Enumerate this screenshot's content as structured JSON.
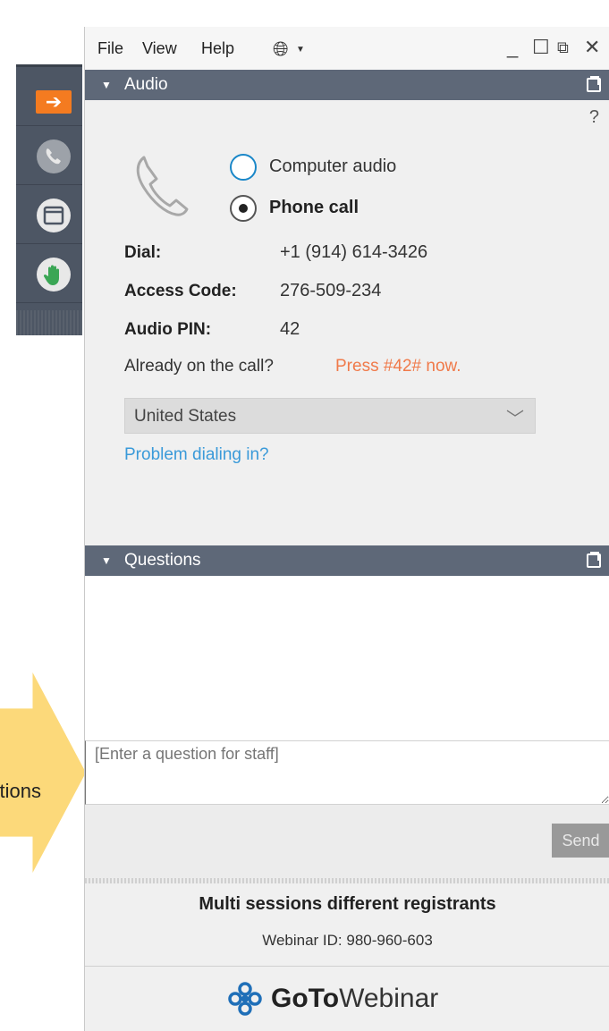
{
  "callout": {
    "text": "Questions"
  },
  "menu": {
    "file": "File",
    "view": "View",
    "help": "Help"
  },
  "audio": {
    "title": "Audio",
    "help": "?",
    "options": [
      {
        "label": "Computer audio",
        "selected": false
      },
      {
        "label": "Phone call",
        "selected": true
      }
    ],
    "dial_label": "Dial:",
    "dial_value": "+1 (914) 614-3426",
    "access_label": "Access Code:",
    "access_value": "276-509-234",
    "pin_label": "Audio PIN:",
    "pin_value": "42",
    "already_text": "Already on the call?",
    "press_text": "Press #42# now.",
    "country": "United States",
    "problem_link": "Problem dialing in?"
  },
  "questions": {
    "title": "Questions",
    "placeholder": "[Enter a question for staff]",
    "send_label": "Send"
  },
  "footer": {
    "session_title": "Multi sessions different registrants",
    "webinar_id": "Webinar ID: 980-960-603",
    "logo_bold": "GoTo",
    "logo_rest": "Webinar"
  },
  "colors": {
    "header": "#5e6878",
    "accent_orange": "#f47b20",
    "link_blue": "#3a9ad9",
    "press_orange": "#f07a4a",
    "callout_yellow": "#fcd97a"
  }
}
